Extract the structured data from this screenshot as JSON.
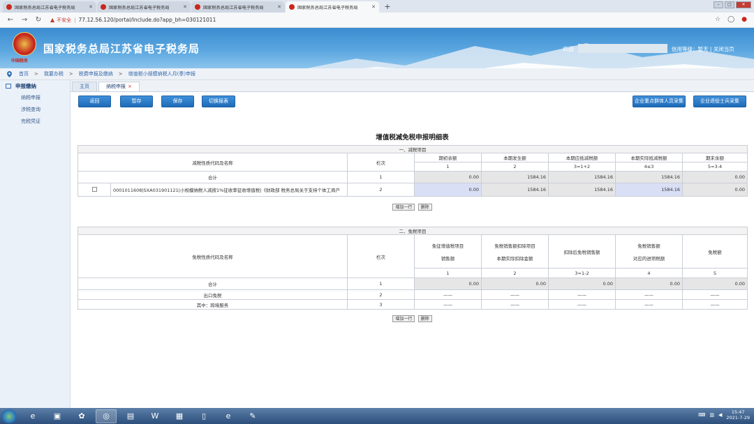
{
  "browser": {
    "tabs": [
      {
        "label": "国家税务总局江苏省电子税务局",
        "active": false
      },
      {
        "label": "国家税务总局江苏省电子税务局",
        "active": false
      },
      {
        "label": "国家税务总局江苏省电子税务局",
        "active": false
      },
      {
        "label": "国家税务总局江苏省电子税务局",
        "active": true
      }
    ],
    "insecure_label": "不安全",
    "url": "77.12.56.120/portal/Include.do?app_bh=030121011"
  },
  "header": {
    "emblem_sub": "中国税务",
    "site_title": "国家税务总局江苏省电子税务局",
    "welcome": "欢迎",
    "credit_label": "信用等级：暂无",
    "close_label": "关闭当页"
  },
  "breadcrumb": [
    "首页",
    "我要办税",
    "税费申报及缴纳",
    "增值税小规模纳税人月(季)申报"
  ],
  "sidebar": {
    "title": "申报缴纳",
    "items": [
      "纳税申报",
      "涉税查询",
      "完税凭证"
    ]
  },
  "page_tabs": {
    "home": "主页",
    "current": "纳税申报"
  },
  "toolbar": {
    "back": "返回",
    "temp_save": "暂存",
    "save": "保存",
    "switch": "切换报表",
    "right1": "企业重点群体人员采集",
    "right2": "企业退役士兵采集"
  },
  "form": {
    "title": "增值税减免税申报明细表",
    "reduction": {
      "section": "一、减税项目",
      "col_name": "减税性质代码及名称",
      "col_row": "栏次",
      "headers": [
        "期初余额",
        "本期发生额",
        "本期应抵减税额",
        "本期实际抵减税额",
        "期末余额"
      ],
      "formulas": [
        "1",
        "2",
        "3=1+2",
        "4≤3",
        "5=3-4"
      ],
      "total": {
        "label": "合计",
        "row": "1",
        "values": [
          "0.00",
          "1584.16",
          "1584.16",
          "1584.16",
          "0.00"
        ]
      },
      "item": {
        "code": "0001011608|SXA031901121|小规模纳税人减按1%征收率征收增值税|《财政部 税务总局关于支持个体工商户",
        "row": "2",
        "values": [
          "0.00",
          "1584.16",
          "1584.16",
          "1584.16",
          "0.00"
        ]
      },
      "add_row": "增加一行",
      "delete": "删除"
    },
    "exemption": {
      "section": "二、免税项目",
      "col_name": "免税性质代码及名称",
      "col_row": "栏次",
      "headers": [
        {
          "l1": "免征增值税项目",
          "l2": "销售额"
        },
        {
          "l1": "免税销售额扣除项目",
          "l2": "本期实际扣除金额"
        },
        {
          "l1": "扣除后免税销售额",
          "l2": ""
        },
        {
          "l1": "免税销售额",
          "l2": "对应的进项税额"
        },
        {
          "l1": "免税额",
          "l2": ""
        }
      ],
      "formulas": [
        "1",
        "2",
        "3=1-2",
        "4",
        "5"
      ],
      "rows": [
        {
          "label": "合计",
          "row": "1",
          "values": [
            "0.00",
            "0.00",
            "0.00",
            "0.00",
            "0.00"
          ]
        },
        {
          "label": "出口免税",
          "row": "2",
          "values": [
            "——",
            "——",
            "——",
            "——",
            "——"
          ]
        },
        {
          "label": "其中：跨境服务",
          "row": "3",
          "values": [
            "——",
            "——",
            "——",
            "——",
            "——"
          ]
        }
      ],
      "add_row": "增加一行",
      "delete": "删除"
    }
  },
  "taskbar": {
    "time": "15:47",
    "date": "2021-7-29"
  }
}
